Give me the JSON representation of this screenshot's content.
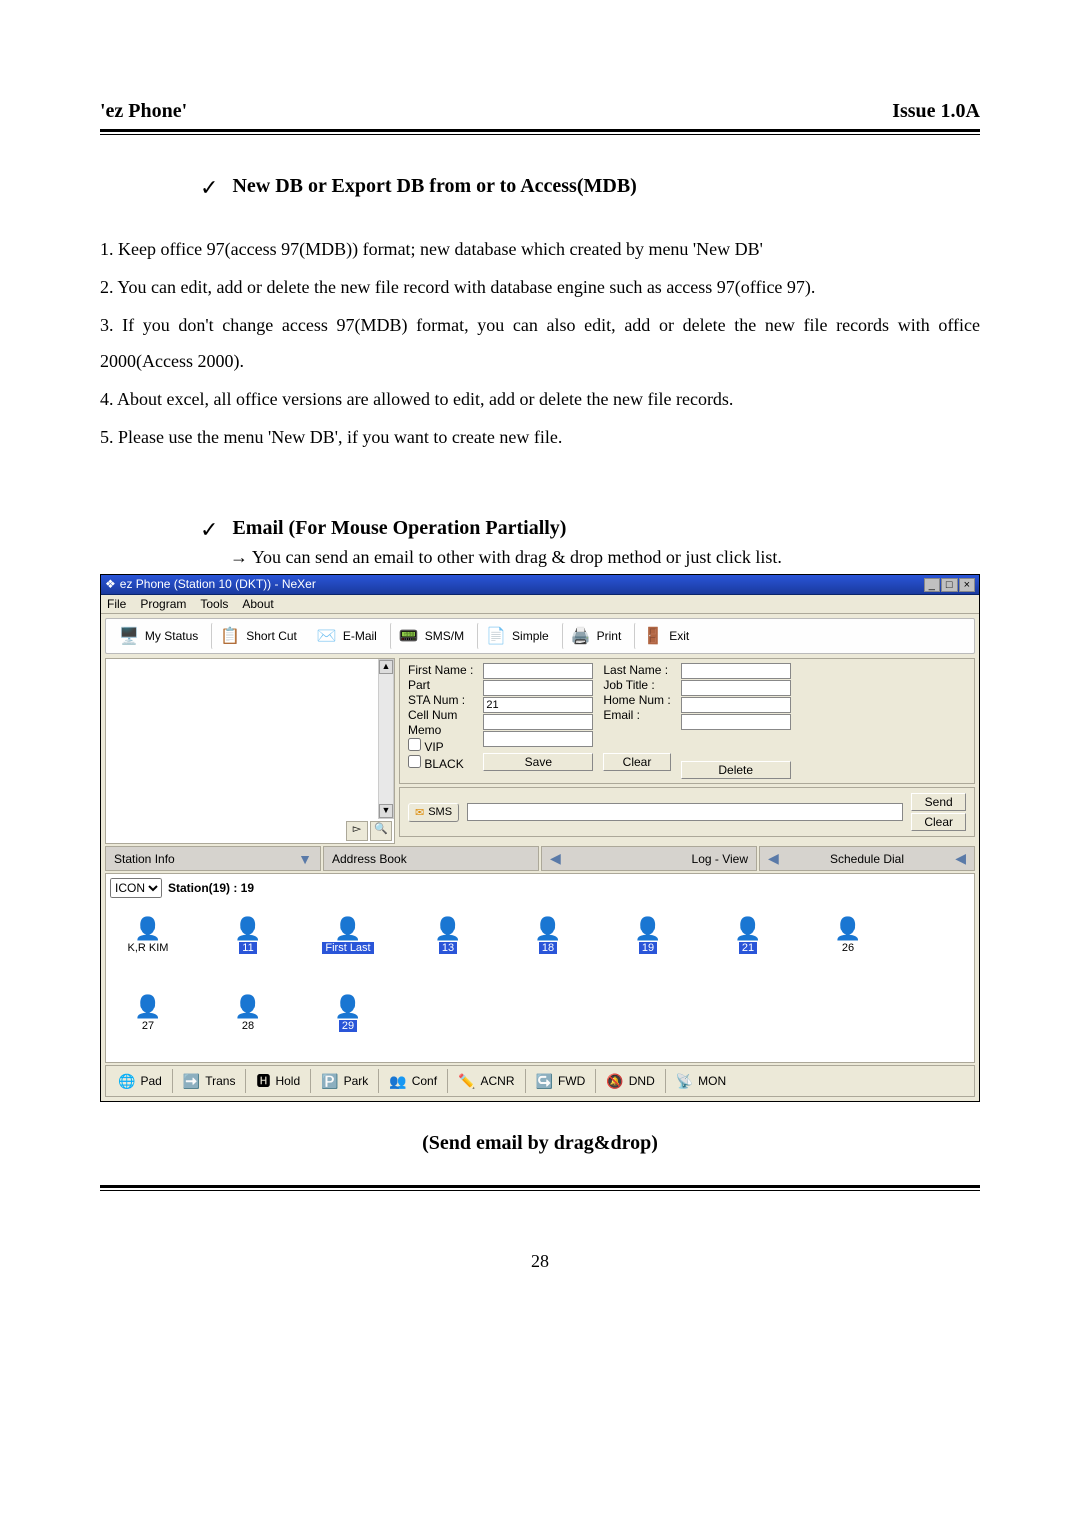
{
  "header": {
    "left": "'ez Phone'",
    "right": "Issue 1.0A"
  },
  "sec1": {
    "title": "New DB or Export DB from or to Access(MDB)",
    "p1": "1. Keep office 97(access 97(MDB)) format; new database which created by menu 'New DB'",
    "p2": "2. You can edit, add or delete the new file record with database engine such as access 97(office 97).",
    "p3": "3. If you don't change access 97(MDB) format, you can also edit, add or delete the new file records with office 2000(Access 2000).",
    "p4": "4. About excel, all office versions are allowed to edit, add or delete the new file records.",
    "p5": "5. Please use the menu 'New DB', if you want to create new file."
  },
  "sec2": {
    "title": "Email (For Mouse Operation Partially)",
    "arrow": "→ You can send an email to other with drag & drop method or just click list."
  },
  "window": {
    "title": "ez Phone (Station 10 (DKT)) - NeXer",
    "menu": [
      "File",
      "Program",
      "Tools",
      "About"
    ],
    "toolbar": [
      {
        "label": "My Status"
      },
      {
        "label": "Short Cut"
      },
      {
        "label": "E-Mail"
      },
      {
        "label": "SMS/M"
      },
      {
        "label": "Simple"
      },
      {
        "label": "Print"
      },
      {
        "label": "Exit"
      }
    ],
    "detail": {
      "first_name": "First Name  :",
      "part": "Part",
      "sta_num": "STA Num   :",
      "sta_val": "21",
      "cell_num": "Cell Num",
      "memo": "Memo",
      "vip": "VIP",
      "black": "BLACK",
      "last_name": "Last Name  :",
      "job_title": "Job Title     :",
      "home_num": "Home Num :",
      "email": "Email          :",
      "save": "Save",
      "clear": "Clear",
      "delete": "Delete"
    },
    "sms": {
      "label": "SMS",
      "send": "Send",
      "clear": "Clear"
    },
    "tabs": [
      {
        "label": "Station Info"
      },
      {
        "label": "Address Book"
      },
      {
        "label": "Log - View"
      },
      {
        "label": "Schedule Dial"
      }
    ],
    "iconArea": {
      "dropdown": "ICON",
      "header": "Station(19) :  19",
      "stations": [
        {
          "label": "K,R KIM"
        },
        {
          "label": "11",
          "sel": true
        },
        {
          "label": "First Last",
          "sel": true
        },
        {
          "label": "13",
          "sel": true
        },
        {
          "label": "18",
          "sel": true
        },
        {
          "label": "19",
          "sel": true
        },
        {
          "label": "21",
          "sel": true
        },
        {
          "label": "26"
        },
        {
          "label": "27"
        },
        {
          "label": "28"
        },
        {
          "label": "29",
          "sel": true
        }
      ]
    },
    "status": [
      {
        "label": "Pad"
      },
      {
        "label": "Trans"
      },
      {
        "label": "Hold"
      },
      {
        "label": "Park"
      },
      {
        "label": "Conf"
      },
      {
        "label": "ACNR"
      },
      {
        "label": "FWD"
      },
      {
        "label": "DND"
      },
      {
        "label": "MON"
      }
    ]
  },
  "caption": "(Send email by drag&drop)",
  "page_num": "28"
}
